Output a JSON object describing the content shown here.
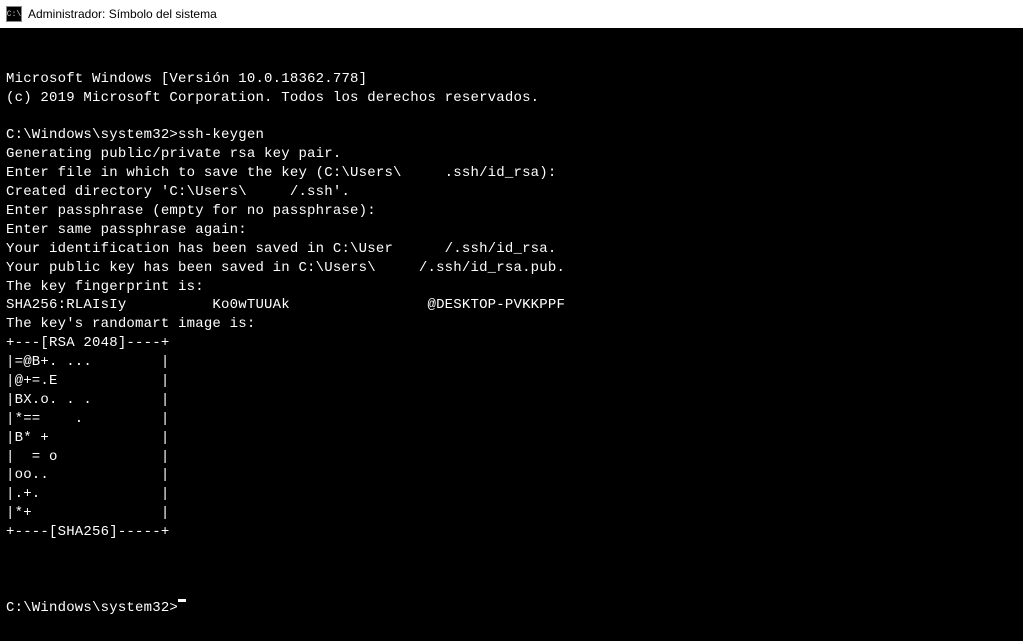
{
  "title_bar": {
    "icon_label": "C:\\",
    "title": "Administrador: Símbolo del sistema"
  },
  "terminal": {
    "lines": [
      "Microsoft Windows [Versión 10.0.18362.778]",
      "(c) 2019 Microsoft Corporation. Todos los derechos reservados.",
      "",
      "C:\\Windows\\system32>ssh-keygen",
      "Generating public/private rsa key pair.",
      "Enter file in which to save the key (C:\\Users\\     .ssh/id_rsa):",
      "Created directory 'C:\\Users\\     /.ssh'.",
      "Enter passphrase (empty for no passphrase):",
      "Enter same passphrase again:",
      "Your identification has been saved in C:\\User      /.ssh/id_rsa.",
      "Your public key has been saved in C:\\Users\\     /.ssh/id_rsa.pub.",
      "The key fingerprint is:",
      "SHA256:RLAIsIy          Ko0wTUUAk                @DESKTOP-PVKKPPF",
      "The key's randomart image is:",
      "+---[RSA 2048]----+",
      "|=@B+. ...        |",
      "|@+=.E            |",
      "|BX.o. . .        |",
      "|*==    .         |",
      "|B* +             |",
      "|  = o            |",
      "|oo..             |",
      "|.+.              |",
      "|*+               |",
      "+----[SHA256]-----+",
      ""
    ],
    "prompt": "C:\\Windows\\system32>"
  }
}
